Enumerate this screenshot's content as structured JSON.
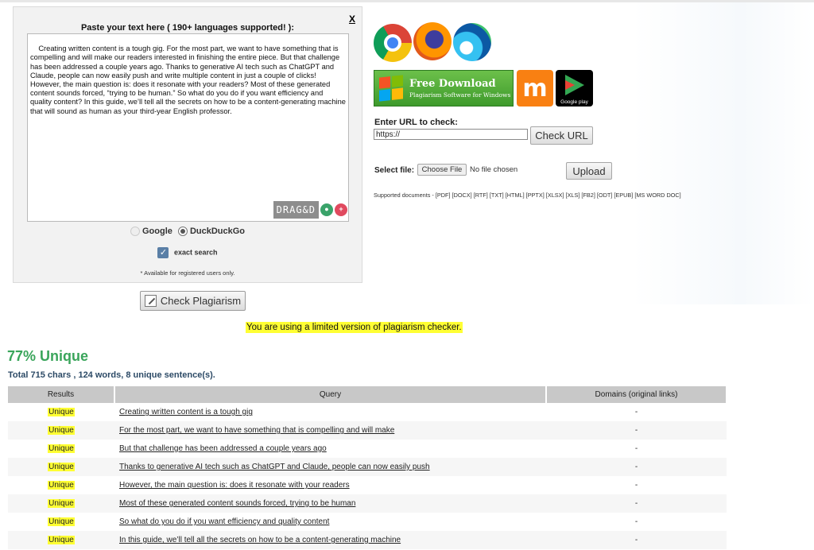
{
  "panel": {
    "title": "Paste your text here ( 190+ languages supported! ):",
    "close": "X",
    "text": "Creating written content is a tough gig. For the most part, we want to have something that is compelling and will make our readers interested in finishing the entire piece. But that challenge has been addressed a couple years ago. Thanks to generative AI tech such as ChatGPT and Claude, people can now easily push and write multiple content in just a couple of clicks!\nHowever, the main question is: does it resonate with your readers? Most of these generated content sounds forced, “trying to be human.” So what do you do if you want efficiency and quality content? In this guide, we’ll tell all the secrets on how to be a content-generating machine that will sound as human as your third-year English professor.",
    "dragdrop_label": "DRAG&D",
    "engines": [
      "Google",
      "DuckDuckGo"
    ],
    "selected_engine": "DuckDuckGo",
    "exact_search": "exact search",
    "exact_checked": true,
    "available_note": "* Available for registered users only."
  },
  "check_plagiarism": "Check Plagiarism",
  "downloads": {
    "free_download": "Free Download",
    "free_download_sub": "Plagiarism Software for Windows",
    "google_play": "Google play",
    "moodle": "m"
  },
  "url": {
    "label": "Enter URL to check:",
    "value": "https://",
    "button": "Check URL"
  },
  "file": {
    "label": "Select file:",
    "choose": "Choose File",
    "status": "No file chosen",
    "upload": "Upload",
    "supported": "Supported documents - [PDF] [DOCX] [RTF] [TXT] [HTML] [PPTX] [XLSX] [XLS] [FB2] [ODT] [EPUB] [MS WORD DOC]"
  },
  "notice": "You are using a limited version of plagiarism checker.",
  "result": {
    "unique": "77% Unique",
    "totals": "Total 715 chars , 124 words, 8 unique sentence(s)."
  },
  "table": {
    "headers": [
      "Results",
      "Query",
      "Domains (original links)"
    ],
    "rows": [
      {
        "result": "Unique",
        "query": "Creating written content is a tough gig",
        "domains": "-"
      },
      {
        "result": "Unique",
        "query": "For the most part, we want to have something that is compelling and will make",
        "domains": "-"
      },
      {
        "result": "Unique",
        "query": "But that challenge has been addressed a couple years ago",
        "domains": "-"
      },
      {
        "result": "Unique",
        "query": "Thanks to generative AI tech such as ChatGPT and Claude, people can now easily push",
        "domains": "-"
      },
      {
        "result": "Unique",
        "query": "However, the main question is: does it resonate with your readers",
        "domains": "-"
      },
      {
        "result": "Unique",
        "query": "Most of these generated content sounds forced, trying to be human",
        "domains": "-"
      },
      {
        "result": "Unique",
        "query": "So what do you do if you want efficiency and quality content",
        "domains": "-"
      },
      {
        "result": "Unique",
        "query": "In this guide, we’ll tell all the secrets on how to be a content-generating machine",
        "domains": "-"
      }
    ]
  },
  "colors": {
    "highlight": "#ffff33",
    "unique_green": "#3aa55b",
    "header_grey": "#c8c8c8",
    "download_green": "#4caf3a",
    "moodle_orange": "#f98012"
  }
}
